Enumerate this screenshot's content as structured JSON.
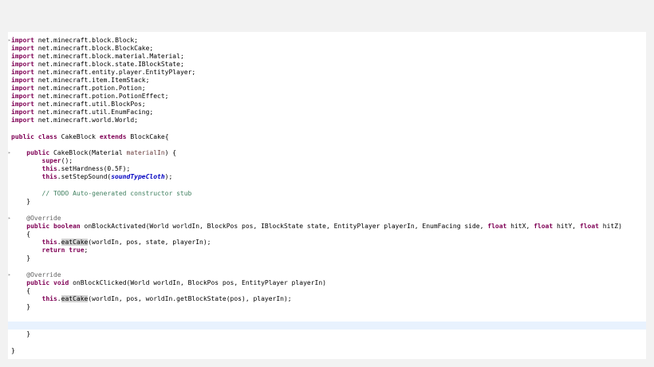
{
  "editor": {
    "imports": [
      "net.minecraft.block.Block;",
      "net.minecraft.block.BlockCake;",
      "net.minecraft.block.material.Material;",
      "net.minecraft.block.state.IBlockState;",
      "net.minecraft.entity.player.EntityPlayer;",
      "net.minecraft.item.ItemStack;",
      "net.minecraft.potion.Potion;",
      "net.minecraft.potion.PotionEffect;",
      "net.minecraft.util.BlockPos;",
      "net.minecraft.util.EnumFacing;",
      "net.minecraft.world.World;"
    ],
    "tokens": {
      "import": "import",
      "public": "public",
      "class": "class",
      "extends": "extends",
      "boolean": "boolean",
      "void": "void",
      "float": "float",
      "super": "super",
      "this": "this",
      "return": "return",
      "true": "true"
    },
    "class_decl": {
      "name": " CakeBlock ",
      "parent": " BlockCake{"
    },
    "constructor": {
      "sig_open": " CakeBlock(Material ",
      "param": "materialIn",
      "sig_close": ") {",
      "super_call": "();",
      "hardness_call": ".setHardness(0.5F);",
      "sound_open": ".setStepSound(",
      "sound_const": "soundTypeCloth",
      "sound_close": ");",
      "todo_comment": "// TODO Auto-generated constructor stub",
      "close": "}"
    },
    "method_activated": {
      "annotation": "@Override",
      "sig_a": " onBlockActivated(World worldIn, BlockPos pos, IBlockState state, EntityPlayer playerIn, EnumFacing side, ",
      "sig_b": " hitX, ",
      "sig_c": " hitY, ",
      "sig_d": " hitZ)",
      "open": "{",
      "call_dot": ".",
      "call_name": "eatCake",
      "call_args": "(worldIn, pos, state, playerIn);",
      "return_end": ";",
      "close": "}"
    },
    "method_clicked": {
      "annotation": "@Override",
      "sig": " onBlockClicked(World worldIn, BlockPos pos, EntityPlayer playerIn)",
      "open": "{",
      "call_dot": ".",
      "call_name": "eatCake",
      "call_args": "(worldIn, pos, worldIn.getBlockState(pos), playerIn);",
      "close": "}"
    },
    "inner_close": "}",
    "file_close": "}"
  },
  "colors": {
    "keyword": "#7f0055",
    "comment": "#3f7f5f",
    "annotation": "#646464",
    "parameter": "#6a3e3e",
    "static_field": "#0000c0",
    "current_line": "#e8f2fe",
    "occurrence_highlight": "#d4d4d4"
  },
  "icons": {
    "fold": "fold-marker-icon"
  }
}
